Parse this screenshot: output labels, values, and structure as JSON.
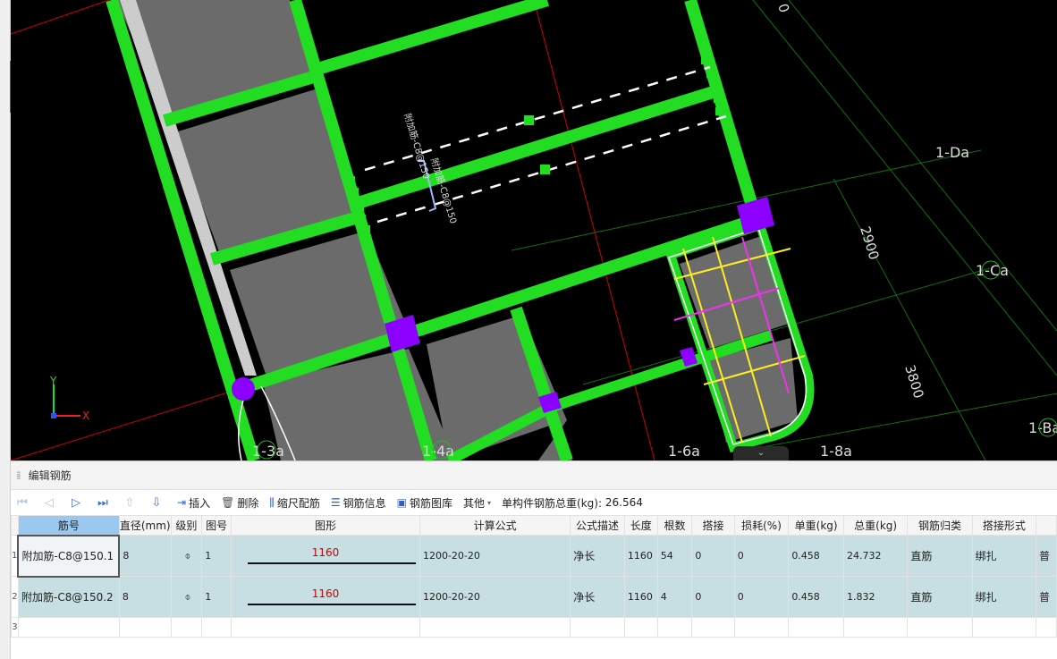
{
  "viewport": {
    "axis_labels": [
      "1-Da",
      "1-Ca",
      "1-Ba",
      "1-3a",
      "1-4a",
      "1-6a",
      "1-8a"
    ],
    "dimensions": [
      "2900",
      "3800"
    ],
    "rebar_annotations": [
      "附加筋-C8@150",
      "附加筋-C8@150"
    ],
    "ucs": {
      "x": "X",
      "y": "Y"
    },
    "colors": {
      "slab_edge": "#22dd22",
      "column": "#8b00ff",
      "grid": "#0f6f0f",
      "axis_red": "#d00000",
      "fill_gray": "#6b6b6b"
    }
  },
  "panel": {
    "title": "编辑钢筋",
    "toolbar": {
      "insert": "插入",
      "delete": "删除",
      "scale_rebar": "缩尺配筋",
      "rebar_info": "钢筋信息",
      "rebar_library": "钢筋图库",
      "other": "其他",
      "total_weight_label": "单构件钢筋总重(kg):",
      "total_weight_value": "26.564"
    },
    "columns": [
      "筋号",
      "直径(mm)",
      "级别",
      "图号",
      "图形",
      "计算公式",
      "公式描述",
      "长度",
      "根数",
      "搭接",
      "损耗(%)",
      "单重(kg)",
      "总重(kg)",
      "钢筋归类",
      "搭接形式",
      ""
    ],
    "rows": [
      {
        "no": "1",
        "name": "附加筋-C8@150.1",
        "diameter": "8",
        "grade": "⌽",
        "fig": "1",
        "shape_len": "1160",
        "formula": "1200-20-20",
        "desc": "净长",
        "length": "1160",
        "count": "54",
        "lap": "0",
        "loss": "0",
        "unit_w": "0.458",
        "total_w": "24.732",
        "category": "直筋",
        "lap_type": "绑扎",
        "extra": "普"
      },
      {
        "no": "2",
        "name": "附加筋-C8@150.2",
        "diameter": "8",
        "grade": "⌽",
        "fig": "1",
        "shape_len": "1160",
        "formula": "1200-20-20",
        "desc": "净长",
        "length": "1160",
        "count": "4",
        "lap": "0",
        "loss": "0",
        "unit_w": "0.458",
        "total_w": "1.832",
        "category": "直筋",
        "lap_type": "绑扎",
        "extra": "普"
      }
    ],
    "empty_row_no": "3"
  }
}
